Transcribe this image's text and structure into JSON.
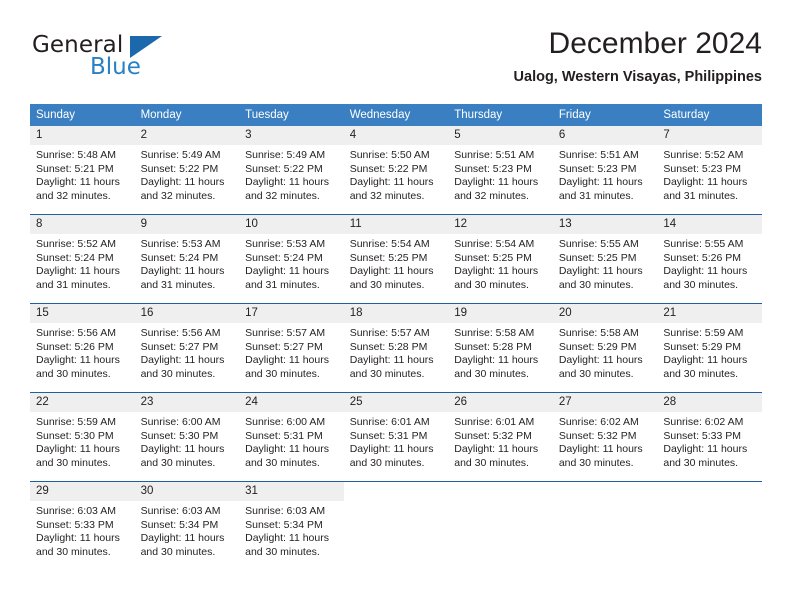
{
  "brand": {
    "name_top": "General",
    "name_bottom": "Blue",
    "accent_color": "#2980c4",
    "triangle_color": "#1b68ad"
  },
  "header": {
    "title": "December 2024",
    "subtitle": "Ualog, Western Visayas, Philippines"
  },
  "calendar": {
    "header_bg": "#3a7fc1",
    "daynum_bg": "#efefef",
    "separator_color": "#1f5fa0",
    "weekday_headers": [
      "Sunday",
      "Monday",
      "Tuesday",
      "Wednesday",
      "Thursday",
      "Friday",
      "Saturday"
    ],
    "weeks": [
      [
        {
          "day": "1",
          "sunrise": "Sunrise: 5:48 AM",
          "sunset": "Sunset: 5:21 PM",
          "daylight_line1": "Daylight: 11 hours",
          "daylight_line2": "and 32 minutes."
        },
        {
          "day": "2",
          "sunrise": "Sunrise: 5:49 AM",
          "sunset": "Sunset: 5:22 PM",
          "daylight_line1": "Daylight: 11 hours",
          "daylight_line2": "and 32 minutes."
        },
        {
          "day": "3",
          "sunrise": "Sunrise: 5:49 AM",
          "sunset": "Sunset: 5:22 PM",
          "daylight_line1": "Daylight: 11 hours",
          "daylight_line2": "and 32 minutes."
        },
        {
          "day": "4",
          "sunrise": "Sunrise: 5:50 AM",
          "sunset": "Sunset: 5:22 PM",
          "daylight_line1": "Daylight: 11 hours",
          "daylight_line2": "and 32 minutes."
        },
        {
          "day": "5",
          "sunrise": "Sunrise: 5:51 AM",
          "sunset": "Sunset: 5:23 PM",
          "daylight_line1": "Daylight: 11 hours",
          "daylight_line2": "and 32 minutes."
        },
        {
          "day": "6",
          "sunrise": "Sunrise: 5:51 AM",
          "sunset": "Sunset: 5:23 PM",
          "daylight_line1": "Daylight: 11 hours",
          "daylight_line2": "and 31 minutes."
        },
        {
          "day": "7",
          "sunrise": "Sunrise: 5:52 AM",
          "sunset": "Sunset: 5:23 PM",
          "daylight_line1": "Daylight: 11 hours",
          "daylight_line2": "and 31 minutes."
        }
      ],
      [
        {
          "day": "8",
          "sunrise": "Sunrise: 5:52 AM",
          "sunset": "Sunset: 5:24 PM",
          "daylight_line1": "Daylight: 11 hours",
          "daylight_line2": "and 31 minutes."
        },
        {
          "day": "9",
          "sunrise": "Sunrise: 5:53 AM",
          "sunset": "Sunset: 5:24 PM",
          "daylight_line1": "Daylight: 11 hours",
          "daylight_line2": "and 31 minutes."
        },
        {
          "day": "10",
          "sunrise": "Sunrise: 5:53 AM",
          "sunset": "Sunset: 5:24 PM",
          "daylight_line1": "Daylight: 11 hours",
          "daylight_line2": "and 31 minutes."
        },
        {
          "day": "11",
          "sunrise": "Sunrise: 5:54 AM",
          "sunset": "Sunset: 5:25 PM",
          "daylight_line1": "Daylight: 11 hours",
          "daylight_line2": "and 30 minutes."
        },
        {
          "day": "12",
          "sunrise": "Sunrise: 5:54 AM",
          "sunset": "Sunset: 5:25 PM",
          "daylight_line1": "Daylight: 11 hours",
          "daylight_line2": "and 30 minutes."
        },
        {
          "day": "13",
          "sunrise": "Sunrise: 5:55 AM",
          "sunset": "Sunset: 5:25 PM",
          "daylight_line1": "Daylight: 11 hours",
          "daylight_line2": "and 30 minutes."
        },
        {
          "day": "14",
          "sunrise": "Sunrise: 5:55 AM",
          "sunset": "Sunset: 5:26 PM",
          "daylight_line1": "Daylight: 11 hours",
          "daylight_line2": "and 30 minutes."
        }
      ],
      [
        {
          "day": "15",
          "sunrise": "Sunrise: 5:56 AM",
          "sunset": "Sunset: 5:26 PM",
          "daylight_line1": "Daylight: 11 hours",
          "daylight_line2": "and 30 minutes."
        },
        {
          "day": "16",
          "sunrise": "Sunrise: 5:56 AM",
          "sunset": "Sunset: 5:27 PM",
          "daylight_line1": "Daylight: 11 hours",
          "daylight_line2": "and 30 minutes."
        },
        {
          "day": "17",
          "sunrise": "Sunrise: 5:57 AM",
          "sunset": "Sunset: 5:27 PM",
          "daylight_line1": "Daylight: 11 hours",
          "daylight_line2": "and 30 minutes."
        },
        {
          "day": "18",
          "sunrise": "Sunrise: 5:57 AM",
          "sunset": "Sunset: 5:28 PM",
          "daylight_line1": "Daylight: 11 hours",
          "daylight_line2": "and 30 minutes."
        },
        {
          "day": "19",
          "sunrise": "Sunrise: 5:58 AM",
          "sunset": "Sunset: 5:28 PM",
          "daylight_line1": "Daylight: 11 hours",
          "daylight_line2": "and 30 minutes."
        },
        {
          "day": "20",
          "sunrise": "Sunrise: 5:58 AM",
          "sunset": "Sunset: 5:29 PM",
          "daylight_line1": "Daylight: 11 hours",
          "daylight_line2": "and 30 minutes."
        },
        {
          "day": "21",
          "sunrise": "Sunrise: 5:59 AM",
          "sunset": "Sunset: 5:29 PM",
          "daylight_line1": "Daylight: 11 hours",
          "daylight_line2": "and 30 minutes."
        }
      ],
      [
        {
          "day": "22",
          "sunrise": "Sunrise: 5:59 AM",
          "sunset": "Sunset: 5:30 PM",
          "daylight_line1": "Daylight: 11 hours",
          "daylight_line2": "and 30 minutes."
        },
        {
          "day": "23",
          "sunrise": "Sunrise: 6:00 AM",
          "sunset": "Sunset: 5:30 PM",
          "daylight_line1": "Daylight: 11 hours",
          "daylight_line2": "and 30 minutes."
        },
        {
          "day": "24",
          "sunrise": "Sunrise: 6:00 AM",
          "sunset": "Sunset: 5:31 PM",
          "daylight_line1": "Daylight: 11 hours",
          "daylight_line2": "and 30 minutes."
        },
        {
          "day": "25",
          "sunrise": "Sunrise: 6:01 AM",
          "sunset": "Sunset: 5:31 PM",
          "daylight_line1": "Daylight: 11 hours",
          "daylight_line2": "and 30 minutes."
        },
        {
          "day": "26",
          "sunrise": "Sunrise: 6:01 AM",
          "sunset": "Sunset: 5:32 PM",
          "daylight_line1": "Daylight: 11 hours",
          "daylight_line2": "and 30 minutes."
        },
        {
          "day": "27",
          "sunrise": "Sunrise: 6:02 AM",
          "sunset": "Sunset: 5:32 PM",
          "daylight_line1": "Daylight: 11 hours",
          "daylight_line2": "and 30 minutes."
        },
        {
          "day": "28",
          "sunrise": "Sunrise: 6:02 AM",
          "sunset": "Sunset: 5:33 PM",
          "daylight_line1": "Daylight: 11 hours",
          "daylight_line2": "and 30 minutes."
        }
      ],
      [
        {
          "day": "29",
          "sunrise": "Sunrise: 6:03 AM",
          "sunset": "Sunset: 5:33 PM",
          "daylight_line1": "Daylight: 11 hours",
          "daylight_line2": "and 30 minutes."
        },
        {
          "day": "30",
          "sunrise": "Sunrise: 6:03 AM",
          "sunset": "Sunset: 5:34 PM",
          "daylight_line1": "Daylight: 11 hours",
          "daylight_line2": "and 30 minutes."
        },
        {
          "day": "31",
          "sunrise": "Sunrise: 6:03 AM",
          "sunset": "Sunset: 5:34 PM",
          "daylight_line1": "Daylight: 11 hours",
          "daylight_line2": "and 30 minutes."
        },
        {
          "day": "",
          "sunrise": "",
          "sunset": "",
          "daylight_line1": "",
          "daylight_line2": ""
        },
        {
          "day": "",
          "sunrise": "",
          "sunset": "",
          "daylight_line1": "",
          "daylight_line2": ""
        },
        {
          "day": "",
          "sunrise": "",
          "sunset": "",
          "daylight_line1": "",
          "daylight_line2": ""
        },
        {
          "day": "",
          "sunrise": "",
          "sunset": "",
          "daylight_line1": "",
          "daylight_line2": ""
        }
      ]
    ]
  }
}
